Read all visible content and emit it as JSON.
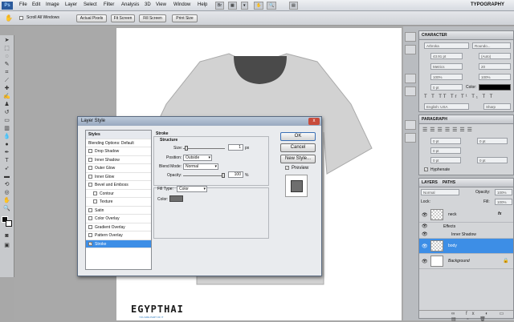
{
  "menubar": {
    "logo": "Ps",
    "items": [
      "File",
      "Edit",
      "Image",
      "Layer",
      "Select",
      "Filter",
      "Analysis",
      "3D",
      "View",
      "Window",
      "Help"
    ],
    "workspace": "TYPOGRAPHY"
  },
  "options_bar": {
    "checkbox_label": "Scroll All Windows",
    "buttons": [
      "Actual Pixels",
      "Fit Screen",
      "Fill Screen",
      "Print Size"
    ]
  },
  "document": {
    "watermark": "EGYPTHAI",
    "watermark_sub": "YOU ARE PART OF IT"
  },
  "character_panel": {
    "tab": "CHARACTER",
    "font_family": "Arbroka",
    "font_style": "Roundo...",
    "size": "43.91 pt",
    "leading": "(Auto)",
    "kerning": "Metrics",
    "tracking": "20",
    "vscale": "100%",
    "hscale": "100%",
    "baseline": "0 pt",
    "color_label": "Color:",
    "language": "English: USA",
    "aa": "Sharp"
  },
  "paragraph_panel": {
    "tab": "PARAGRAPH",
    "indent_values": [
      "0 pt",
      "0 pt",
      "0 pt",
      "0 pt",
      "0 pt"
    ],
    "hyphenate_label": "Hyphenate"
  },
  "layers_panel": {
    "tabs": [
      "LAYERS",
      "PATHS"
    ],
    "blend_mode": "Normal",
    "opacity_label": "Opacity:",
    "opacity": "100%",
    "lock_label": "Lock:",
    "fill_label": "Fill:",
    "fill": "100%",
    "layers": [
      {
        "name": "neck",
        "fx": "fx"
      },
      {
        "name": "Effects"
      },
      {
        "name": "Inner Shadow"
      },
      {
        "name": "body",
        "selected": true
      },
      {
        "name": "Background"
      }
    ]
  },
  "dialog": {
    "title": "Layer Style",
    "close": "x",
    "styles_header": "Styles",
    "blending_options": "Blending Options: Default",
    "style_items": [
      {
        "label": "Drop Shadow",
        "checked": false
      },
      {
        "label": "Inner Shadow",
        "checked": false
      },
      {
        "label": "Outer Glow",
        "checked": false
      },
      {
        "label": "Inner Glow",
        "checked": false
      },
      {
        "label": "Bevel and Emboss",
        "checked": false
      },
      {
        "label": "Contour",
        "checked": false
      },
      {
        "label": "Texture",
        "checked": false
      },
      {
        "label": "Satin",
        "checked": false
      },
      {
        "label": "Color Overlay",
        "checked": false
      },
      {
        "label": "Gradient Overlay",
        "checked": false
      },
      {
        "label": "Pattern Overlay",
        "checked": false
      },
      {
        "label": "Stroke",
        "checked": true
      }
    ],
    "section_title": "Stroke",
    "structure_title": "Structure",
    "size_label": "Size:",
    "size_value": "1",
    "size_unit": "px",
    "position_label": "Position:",
    "position_value": "Outside",
    "blend_label": "Blend Mode:",
    "blend_value": "Normal",
    "opacity_label": "Opacity:",
    "opacity_value": "100",
    "opacity_unit": "%",
    "filltype_label": "Fill Type:",
    "filltype_value": "Color",
    "color_label": "Color:",
    "buttons": {
      "ok": "OK",
      "cancel": "Cancel",
      "new_style": "New Style..."
    },
    "preview_label": "Preview"
  },
  "colors": {
    "selected_row": "#3d8ee6",
    "stroke_swatch": "#6e6e6e",
    "tshirt": "#d2d2d2",
    "neck": "#4a4a4a"
  }
}
